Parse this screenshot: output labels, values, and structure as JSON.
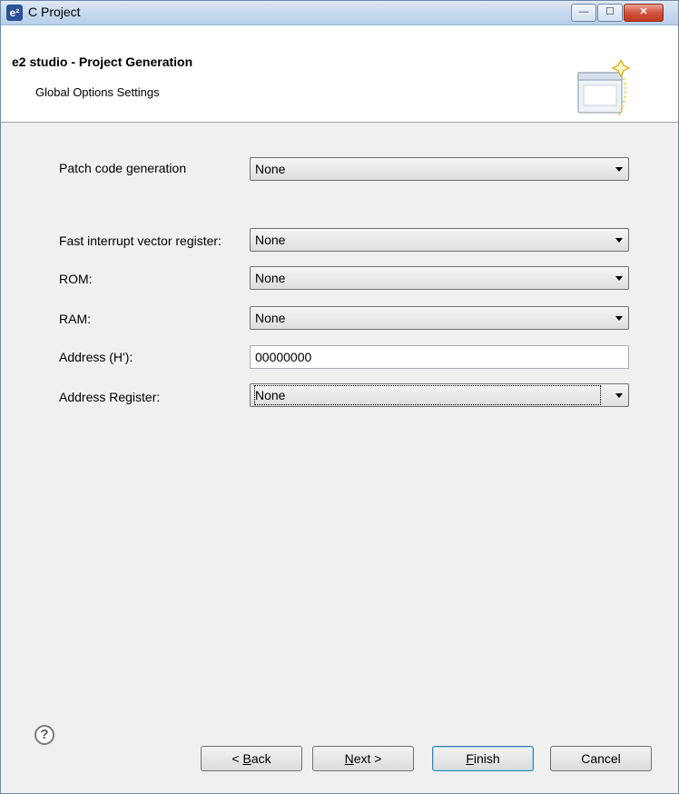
{
  "window": {
    "app_icon_text": "e²",
    "title": "C Project",
    "minimize_glyph": "—",
    "maximize_glyph": "☐",
    "close_glyph": "✕"
  },
  "header": {
    "title": "e2 studio - Project Generation",
    "subtitle": "Global Options Settings",
    "graphic_icon": "wizard-sparkle-icon"
  },
  "form": {
    "patch_code": {
      "label": "Patch code generation",
      "value": "None"
    },
    "fast_interrupt": {
      "label": "Fast interrupt vector register:",
      "value": "None"
    },
    "rom": {
      "label": "ROM:",
      "value": "None"
    },
    "ram": {
      "label": "RAM:",
      "value": "None"
    },
    "address": {
      "label": "Address (H'):",
      "value": "00000000"
    },
    "address_register": {
      "label": "Address Register:",
      "value": "None"
    }
  },
  "footer": {
    "help_glyph": "?",
    "back": {
      "mnemonic": "B",
      "prefix": "< ",
      "rest": "ack"
    },
    "next": {
      "mnemonic": "N",
      "rest": "ext >"
    },
    "finish": {
      "mnemonic": "F",
      "rest": "inish"
    },
    "cancel": "Cancel"
  },
  "colors": {
    "title_bar": "#c5d7ee",
    "close_button": "#d2543f",
    "default_button_border": "#3c7fb1"
  }
}
